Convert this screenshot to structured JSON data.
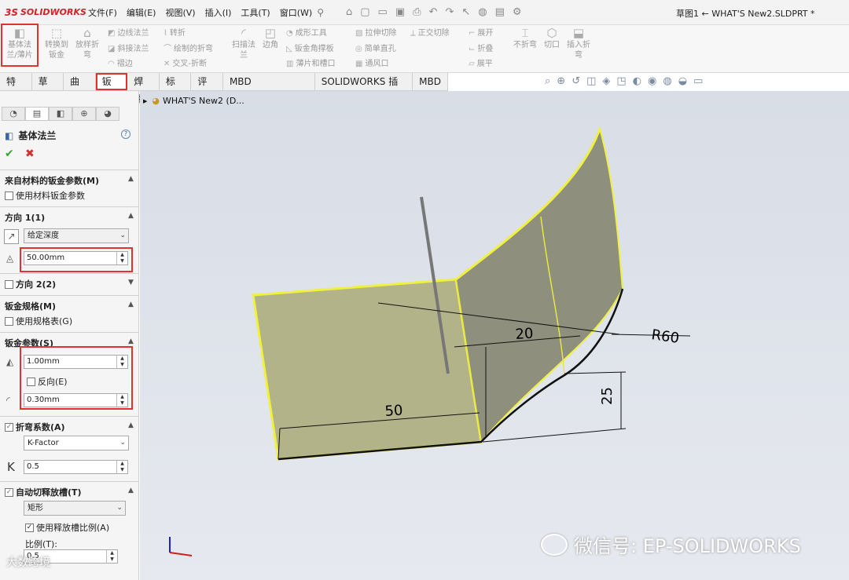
{
  "app": {
    "logo_prefix": "3S",
    "logo_text": "SOLIDWORKS",
    "doc_title": "草图1 ← WHAT'S New2.SLDPRT *"
  },
  "menu": [
    "文件(F)",
    "编辑(E)",
    "视图(V)",
    "插入(I)",
    "工具(T)",
    "窗口(W)"
  ],
  "ribbon": {
    "base_flange": "基体法兰/薄片",
    "convert_sheet": "转换到钣金",
    "loft_bend": "放样折弯",
    "edge_flange": "边线法兰",
    "miter_flange": "斜接法兰",
    "hem": "褶边",
    "jog": "转折",
    "sketched_bend": "绘制的折弯",
    "cross_break": "交叉-折断",
    "swept_flange": "扫描法兰",
    "corners": "边角",
    "forming_tool": "成形工具",
    "gusset": "钣金角撑板",
    "tab_slot": "薄片和槽口",
    "extruded_cut": "拉伸切除",
    "simple_hole": "简单直孔",
    "vent": "通风口",
    "normal_cut": "正交切除",
    "unfold": "展开",
    "fold": "折叠",
    "flatten": "展平",
    "no_bends": "不折弯",
    "rip": "切口",
    "insert_bends": "插入折弯"
  },
  "tabs": [
    "特征",
    "草图",
    "曲面",
    "钣金",
    "焊件",
    "标注",
    "评估",
    "MBD Dimensions",
    "SOLIDWORKS 插件",
    "MBD"
  ],
  "panel": {
    "title": "基体法兰",
    "help": "?",
    "sec_material": "来自材料的钣金参数(M)",
    "use_material": "使用材料钣金参数",
    "sec_dir1": "方向 1(1)",
    "end_condition": "给定深度",
    "depth": "50.00mm",
    "sec_dir2": "方向 2(2)",
    "sec_gauge": "钣金规格(M)",
    "use_gauge": "使用规格表(G)",
    "sec_params": "钣金参数(S)",
    "thickness": "1.00mm",
    "reverse": "反向(E)",
    "radius": "0.30mm",
    "sec_bend": "折弯系数(A)",
    "bend_type": "K-Factor",
    "k_symbol": "K",
    "k_value": "0.5",
    "sec_relief": "自动切释放槽(T)",
    "relief_type": "矩形",
    "use_ratio": "使用释放槽比例(A)",
    "ratio_label": "比例(T):",
    "ratio_value": "0.5"
  },
  "viewport": {
    "tree_root": "WHAT'S New2 (D...",
    "dim_r": "R60",
    "dim_20": "20",
    "dim_50": "50",
    "dim_25": "25",
    "watermark": "微信号: EP-SOLIDWORKS",
    "watermark2": "大数跨境"
  }
}
